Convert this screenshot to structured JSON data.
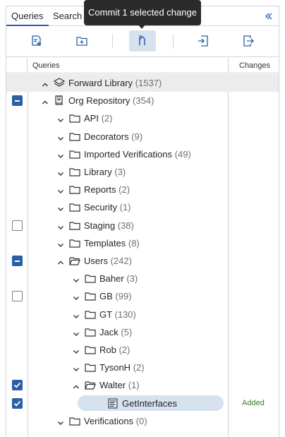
{
  "tabs": [
    {
      "label": "Queries"
    },
    {
      "label": "Search"
    }
  ],
  "tooltip": "Commit 1 selected change",
  "columns": {
    "queries": "Queries",
    "changes": "Changes"
  },
  "rows": [
    {
      "indent": 0,
      "expanded": true,
      "icon": "layers-icon",
      "label": "Forward Library",
      "count": "(1537)",
      "check": "none",
      "highlight": true,
      "change": ""
    },
    {
      "indent": 0,
      "expanded": true,
      "icon": "book-icon",
      "label": "Org Repository",
      "count": "(354)",
      "check": "partial",
      "change": ""
    },
    {
      "indent": 1,
      "expanded": false,
      "icon": "folder-icon",
      "label": "API",
      "count": "(2)",
      "check": "none",
      "change": ""
    },
    {
      "indent": 1,
      "expanded": false,
      "icon": "folder-icon",
      "label": "Decorators",
      "count": "(9)",
      "check": "none",
      "change": ""
    },
    {
      "indent": 1,
      "expanded": false,
      "icon": "folder-icon",
      "label": "Imported Verifications",
      "count": "(49)",
      "check": "none",
      "change": ""
    },
    {
      "indent": 1,
      "expanded": false,
      "icon": "folder-icon",
      "label": "Library",
      "count": "(3)",
      "check": "none",
      "change": ""
    },
    {
      "indent": 1,
      "expanded": false,
      "icon": "folder-icon",
      "label": "Reports",
      "count": "(2)",
      "check": "none",
      "change": ""
    },
    {
      "indent": 1,
      "expanded": false,
      "icon": "folder-icon",
      "label": "Security",
      "count": "(1)",
      "check": "none",
      "change": ""
    },
    {
      "indent": 1,
      "expanded": false,
      "icon": "folder-icon",
      "label": "Staging",
      "count": "(38)",
      "check": "empty",
      "change": ""
    },
    {
      "indent": 1,
      "expanded": false,
      "icon": "folder-icon",
      "label": "Templates",
      "count": "(8)",
      "check": "none",
      "change": ""
    },
    {
      "indent": 1,
      "expanded": true,
      "icon": "folder-open-icon",
      "label": "Users",
      "count": "(242)",
      "check": "partial",
      "change": ""
    },
    {
      "indent": 2,
      "expanded": false,
      "icon": "folder-icon",
      "label": "Baher",
      "count": "(3)",
      "check": "none",
      "change": ""
    },
    {
      "indent": 2,
      "expanded": false,
      "icon": "folder-icon",
      "label": "GB",
      "count": "(99)",
      "check": "empty",
      "change": ""
    },
    {
      "indent": 2,
      "expanded": false,
      "icon": "folder-icon",
      "label": "GT",
      "count": "(130)",
      "check": "none",
      "change": ""
    },
    {
      "indent": 2,
      "expanded": false,
      "icon": "folder-icon",
      "label": "Jack",
      "count": "(5)",
      "check": "none",
      "change": ""
    },
    {
      "indent": 2,
      "expanded": false,
      "icon": "folder-icon",
      "label": "Rob",
      "count": "(2)",
      "check": "none",
      "change": ""
    },
    {
      "indent": 2,
      "expanded": false,
      "icon": "folder-icon",
      "label": "TysonH",
      "count": "(2)",
      "check": "none",
      "change": ""
    },
    {
      "indent": 2,
      "expanded": true,
      "icon": "folder-open-icon",
      "label": "Walter",
      "count": "(1)",
      "check": "checked",
      "change": ""
    },
    {
      "indent": 3,
      "expanded": null,
      "icon": "query-file-icon",
      "label": "GetInterfaces",
      "count": "",
      "check": "checked",
      "selected": true,
      "change": "Added"
    },
    {
      "indent": 1,
      "expanded": false,
      "icon": "folder-icon",
      "label": "Verifications",
      "count": "(0)",
      "check": "none",
      "change": ""
    }
  ]
}
